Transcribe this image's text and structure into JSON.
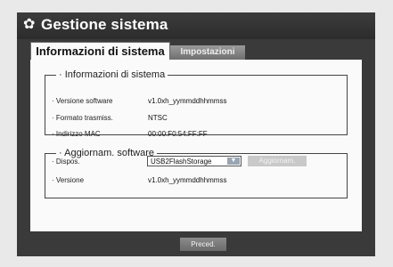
{
  "header": {
    "title": "Gestione sistema",
    "icon": "gear-icon"
  },
  "tabs": [
    {
      "label": "Informazioni di sistema",
      "active": true
    },
    {
      "label": "Impostazioni",
      "active": false
    }
  ],
  "system_info": {
    "legend": "· Informazioni di sistema",
    "rows": [
      {
        "label": "· Versione software",
        "value": "v1.0xh_yymmddhhmmss"
      },
      {
        "label": "· Formato trasmiss.",
        "value": "NTSC"
      },
      {
        "label": "· Indirizzo MAC",
        "value": "00:00:F0:54:FF:FF"
      }
    ]
  },
  "software_update": {
    "legend": "· Aggiornam. software",
    "device_label": "· Dispos.",
    "device_value": "USB2FlashStorage",
    "update_button": "Aggiornam.",
    "version_label": "· Versione",
    "version_value": "v1.0xh_yymmddhhmmss"
  },
  "footer": {
    "prev_button": "Preced."
  }
}
